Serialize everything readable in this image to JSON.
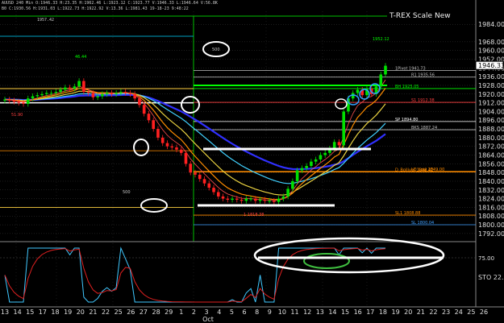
{
  "header": {
    "line1": "AUUSD  240 Min  O:1946.33  H:23.35  H:1962.46  L:1923.12  C:1923.77  V:1946.33  L:1946.64  V:56.8K",
    "line2": "B0  C:1930.56  H:1931.03  L:1922.73  H:1922.92  V:13.36  L:1981.43  19-18-23  9:48:22",
    "line3": "1957.42"
  },
  "title_right": "T-REX Scale New",
  "sto_label": "STO 22.",
  "month_label": "Oct",
  "colors": {
    "up_candle": "#00e000",
    "down_candle": "#ff2020",
    "ema_blue": "#3030ff",
    "ema_cyan": "#40d0ff",
    "ema_yellow": "#e8d040",
    "ema_orange": "#ff8c00",
    "annotation": "#ffffff",
    "osc_cyan": "#40c8ff",
    "osc_red": "#e02020"
  },
  "chart_data": {
    "type": "candlestick",
    "ylim": [
      1786,
      1996
    ],
    "y_ticks": [
      1984,
      1968,
      1960,
      1952,
      1944,
      1936,
      1928,
      1920,
      1912,
      1904,
      1896,
      1888,
      1880,
      1872,
      1864,
      1856,
      1848,
      1840,
      1832,
      1824,
      1816,
      1808,
      1800,
      1792
    ],
    "last_price": 1946.33,
    "x_ticks": [
      "13",
      "14",
      "15",
      "17",
      "18",
      "19",
      "20",
      "21",
      "22",
      "25",
      "26",
      "27",
      "28",
      "29",
      "1",
      "2",
      "3",
      "4",
      "5",
      "6",
      "8",
      "9",
      "10",
      "11",
      "12",
      "13",
      "14",
      "15",
      "16",
      "17",
      "18",
      "19",
      "20",
      "21",
      "22",
      "23",
      "24",
      "25",
      "26"
    ],
    "closes": [
      1915,
      1914,
      1913,
      1912,
      1911,
      1916,
      1918,
      1919,
      1920,
      1921,
      1921,
      1922,
      1924,
      1926,
      1925,
      1927,
      1932,
      1922,
      1921,
      1917,
      1918,
      1920,
      1921,
      1920,
      1921,
      1922,
      1921,
      1920,
      1916,
      1910,
      1902,
      1896,
      1888,
      1880,
      1875,
      1872,
      1871,
      1869,
      1866,
      1856,
      1848,
      1846,
      1842,
      1838,
      1834,
      1830,
      1826,
      1824,
      1823,
      1824,
      1823,
      1822,
      1824,
      1824,
      1822,
      1823,
      1822,
      1822,
      1821,
      1824,
      1826,
      1833,
      1840,
      1850,
      1852,
      1854,
      1858,
      1860,
      1864,
      1866,
      1870,
      1876,
      1873,
      1904,
      1916,
      1921,
      1924,
      1919,
      1925,
      1920,
      1927,
      1938,
      1946
    ],
    "levels": [
      {
        "label": "1Pivot 1941.73",
        "value": 1941.73
      },
      {
        "label": "R1 1935.56",
        "value": 1935.56
      },
      {
        "label": "BH 1925.05",
        "value": 1925.05
      },
      {
        "label": "S1 1912.38",
        "value": 1912.38
      },
      {
        "label": "SP 1894.80",
        "value": 1894.8
      },
      {
        "label": "BKS 1887.24",
        "value": 1887.24
      },
      {
        "label": "D_Bolliver 1848.42",
        "value": 1848.42
      },
      {
        "label": "LD_Low 1849.00",
        "value": 1849.0
      },
      {
        "label": "SL1 1808.88",
        "value": 1808.88
      },
      {
        "label": "SL 1800.04",
        "value": 1800.04
      }
    ],
    "value_labels": [
      "1952.12",
      "500",
      "500",
      "46.44",
      "51.90",
      "1 1818.38"
    ],
    "oscillator": {
      "name": "STO",
      "value": 22,
      "level": 75.0,
      "range": [
        0,
        100
      ]
    }
  }
}
